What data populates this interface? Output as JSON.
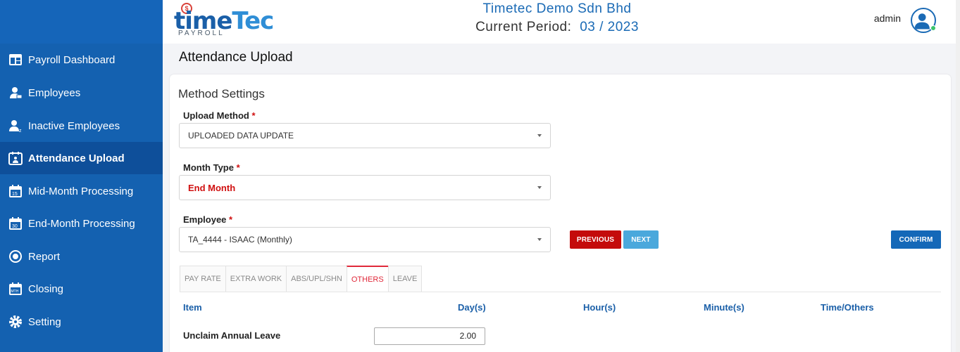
{
  "header": {
    "company": "Timetec Demo Sdn Bhd",
    "period_label": "Current Period:",
    "period_value": "03 / 2023",
    "user": "admin",
    "logo_main": "timeTec",
    "logo_sub": "PAYROLL"
  },
  "sidebar": {
    "items": [
      {
        "label": "Payroll Dashboard",
        "icon": "dashboard-icon"
      },
      {
        "label": "Employees",
        "icon": "employee-icon"
      },
      {
        "label": "Inactive Employees",
        "icon": "inactive-employee-icon"
      },
      {
        "label": "Attendance Upload",
        "icon": "attendance-icon",
        "active": true
      },
      {
        "label": "Mid-Month Processing",
        "icon": "calendar-15-icon"
      },
      {
        "label": "End-Month Processing",
        "icon": "calendar-30-icon"
      },
      {
        "label": "Report",
        "icon": "report-icon"
      },
      {
        "label": "Closing",
        "icon": "closing-icon"
      },
      {
        "label": "Setting",
        "icon": "gear-icon"
      }
    ]
  },
  "page": {
    "title": "Attendance Upload",
    "section_title": "Method Settings",
    "upload_method_label": "Upload Method",
    "upload_method_value": "UPLOADED DATA UPDATE",
    "month_type_label": "Month Type",
    "month_type_value": "End Month",
    "employee_label": "Employee",
    "employee_value": "TA_4444 - ISAAC (Monthly)",
    "required_mark": "*",
    "buttons": {
      "previous": "PREVIOUS",
      "next": "NEXT",
      "confirm": "CONFIRM"
    },
    "tabs": [
      "PAY RATE",
      "EXTRA WORK",
      "ABS/UPL/SHN",
      "OTHERS",
      "LEAVE"
    ],
    "active_tab": "OTHERS",
    "columns": [
      "Item",
      "Day(s)",
      "Hour(s)",
      "Minute(s)",
      "Time/Others"
    ],
    "rows": [
      {
        "item": "Unclaim Annual Leave",
        "days": "2.00"
      }
    ]
  },
  "colors": {
    "sidebar": "#1461b0",
    "accent": "#1a6ab5",
    "danger": "#c40b0b"
  }
}
